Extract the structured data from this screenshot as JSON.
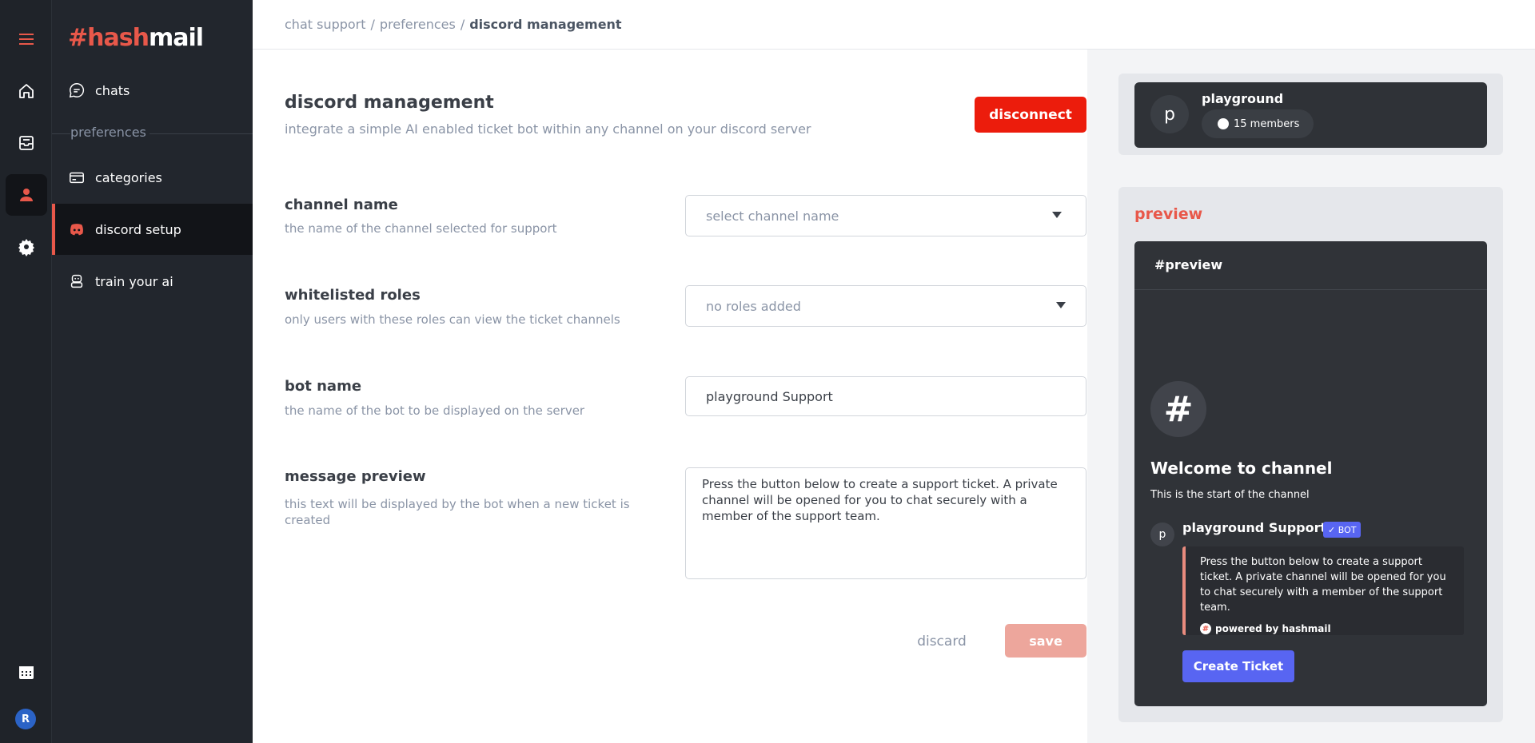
{
  "brand": {
    "hash": "#hash",
    "mail": "mail"
  },
  "sidebar": {
    "chats_label": "chats",
    "section_label": "preferences",
    "items": [
      {
        "label": "categories"
      },
      {
        "label": "discord setup"
      },
      {
        "label": "train your ai"
      }
    ]
  },
  "user": {
    "initial": "R"
  },
  "breadcrumb": {
    "items": [
      "chat support",
      "preferences"
    ],
    "current": "discord management",
    "separator": "/"
  },
  "page": {
    "title": "discord management",
    "subtitle": "integrate a simple AI enabled ticket bot within any channel on your discord server",
    "disconnect_label": "disconnect"
  },
  "form": {
    "channel_name": {
      "label": "channel name",
      "help": "the name of the channel selected for support",
      "placeholder": "select channel name"
    },
    "whitelisted_roles": {
      "label": "whitelisted roles",
      "help": "only users with these roles can view the ticket channels",
      "placeholder": "no roles added"
    },
    "bot_name": {
      "label": "bot name",
      "help": "the name of the bot to be displayed on the server",
      "value": "playground Support"
    },
    "message_preview": {
      "label": "message preview",
      "help": "this text will be displayed by the bot when a new ticket is created",
      "value": "Press the button below to create a support ticket. A private channel will be opened for you to chat securely with a member of the support team."
    },
    "discard_label": "discard",
    "save_label": "save"
  },
  "server": {
    "avatar_initial": "p",
    "name": "playground",
    "members": "15 members"
  },
  "preview": {
    "title": "preview",
    "channel": "#preview",
    "hash_symbol": "#",
    "welcome": "Welcome to channel",
    "start_text": "This is the start of the channel",
    "bot_initial": "p",
    "bot_name": "playground Support",
    "bot_badge": "✓ BOT",
    "embed_text": "Press the button below to create a support ticket. A private channel will be opened for you to chat securely with a member of the support team.",
    "footer_icon": "#",
    "footer_text": "powered by hashmail",
    "button_label": "Create Ticket"
  },
  "colors": {
    "accent": "#e8584a",
    "danger": "#ec1c0c",
    "discord_blurple": "#5865f2",
    "sidebar_bg": "#22262d"
  },
  "icons": [
    "menu-icon",
    "home-icon",
    "inbox-icon",
    "support-agent-icon",
    "gear-icon",
    "calendar-icon",
    "chat-bubble-icon",
    "card-icon",
    "discord-icon",
    "robot-icon",
    "caret-down-icon"
  ]
}
